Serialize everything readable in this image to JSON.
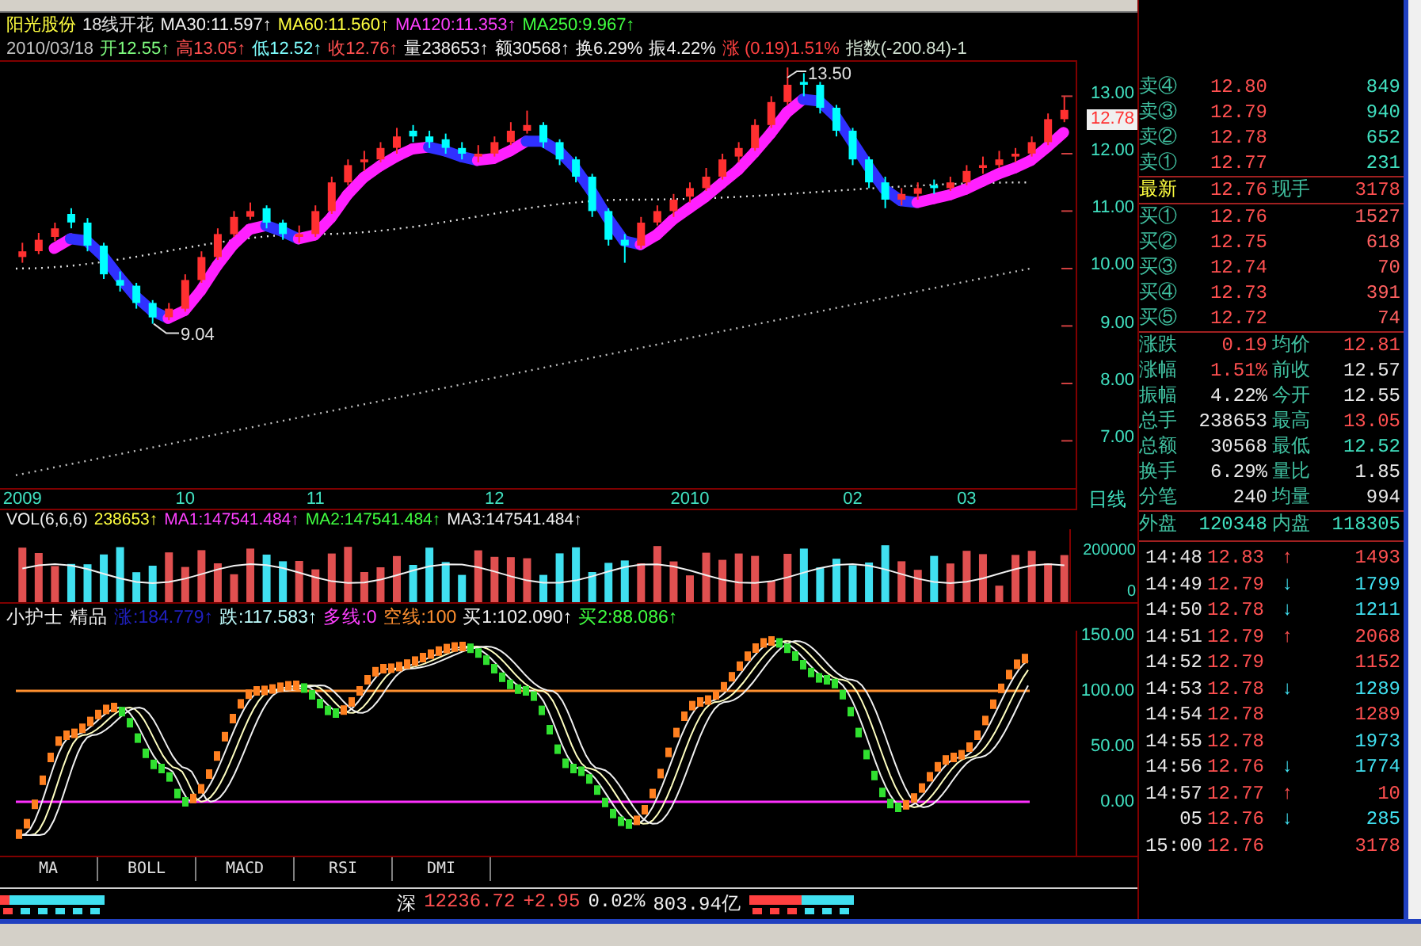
{
  "header": {
    "stock_name": "阳光股份",
    "formula_name": "18线开花",
    "ma_values": [
      {
        "text": "MA30:11.597↑",
        "color": "#f0f0f0"
      },
      {
        "text": "MA60:11.560↑",
        "color": "#ffff40"
      },
      {
        "text": "MA120:11.353↑",
        "color": "#ff40ff"
      },
      {
        "text": "MA250:9.967↑",
        "color": "#40ff40"
      }
    ],
    "quote_line": [
      {
        "text": "2010/03/18",
        "color": "#c0c0c0"
      },
      {
        "text": "开12.55↑",
        "color": "#80ff80"
      },
      {
        "text": "高13.05↑",
        "color": "#ff5050"
      },
      {
        "text": "低12.52↑",
        "color": "#80ffff"
      },
      {
        "text": "收12.76↑",
        "color": "#ff5050"
      },
      {
        "text": "量238653↑",
        "color": "#f0f0f0"
      },
      {
        "text": "额30568↑",
        "color": "#f0f0f0"
      },
      {
        "text": "换6.29%",
        "color": "#f0f0f0"
      },
      {
        "text": "振4.22%",
        "color": "#f0f0f0"
      },
      {
        "text": "涨 (0.19)1.51%",
        "color": "#ff4040"
      },
      {
        "text": "指数(-200.84)-1",
        "color": "#d0e0d0"
      }
    ]
  },
  "price_chart": {
    "high_label": "13.50",
    "low_label": "9.04",
    "current_price": "12.78",
    "chart_data": {
      "type": "candlestick",
      "categories": [
        "2009",
        null,
        null,
        null,
        null,
        null,
        null,
        null,
        null,
        null,
        "10",
        null,
        null,
        null,
        null,
        null,
        null,
        null,
        "11",
        null,
        null,
        null,
        null,
        null,
        null,
        null,
        null,
        null,
        null,
        "12",
        null,
        null,
        null,
        null,
        null,
        null,
        null,
        null,
        null,
        null,
        null,
        "2010",
        null,
        null,
        null,
        null,
        null,
        null,
        null,
        null,
        null,
        "02",
        null,
        null,
        null,
        null,
        null,
        null,
        "03",
        null,
        null,
        null,
        null,
        null,
        null
      ],
      "ohlc": [
        [
          10.2,
          10.45,
          10.1,
          10.3
        ],
        [
          10.3,
          10.62,
          10.25,
          10.5
        ],
        [
          10.55,
          10.8,
          10.48,
          10.7
        ],
        [
          10.95,
          11.05,
          10.7,
          10.8
        ],
        [
          10.8,
          10.88,
          10.3,
          10.4
        ],
        [
          10.4,
          10.45,
          9.82,
          9.9
        ],
        [
          9.8,
          9.95,
          9.6,
          9.7
        ],
        [
          9.7,
          9.75,
          9.3,
          9.4
        ],
        [
          9.4,
          9.45,
          9.04,
          9.15
        ],
        [
          9.15,
          9.4,
          9.1,
          9.3
        ],
        [
          9.3,
          9.9,
          9.25,
          9.8
        ],
        [
          9.8,
          10.3,
          9.75,
          10.2
        ],
        [
          10.2,
          10.7,
          10.15,
          10.6
        ],
        [
          10.6,
          11.0,
          10.55,
          10.9
        ],
        [
          10.9,
          11.15,
          10.85,
          11.0
        ],
        [
          11.05,
          11.1,
          10.7,
          10.8
        ],
        [
          10.8,
          10.85,
          10.5,
          10.6
        ],
        [
          10.55,
          10.75,
          10.45,
          10.6
        ],
        [
          10.6,
          11.1,
          10.55,
          11.0
        ],
        [
          11.0,
          11.6,
          10.95,
          11.5
        ],
        [
          11.5,
          11.9,
          11.45,
          11.8
        ],
        [
          11.85,
          12.05,
          11.7,
          11.9
        ],
        [
          11.9,
          12.2,
          11.85,
          12.1
        ],
        [
          12.1,
          12.45,
          12.0,
          12.3
        ],
        [
          12.4,
          12.5,
          12.2,
          12.3
        ],
        [
          12.3,
          12.4,
          12.1,
          12.2
        ],
        [
          12.25,
          12.35,
          12.0,
          12.1
        ],
        [
          12.1,
          12.2,
          11.9,
          12.0
        ],
        [
          11.95,
          12.15,
          11.85,
          12.0
        ],
        [
          12.0,
          12.3,
          11.95,
          12.2
        ],
        [
          12.2,
          12.55,
          12.15,
          12.4
        ],
        [
          12.4,
          12.75,
          12.35,
          12.5
        ],
        [
          12.5,
          12.55,
          12.1,
          12.2
        ],
        [
          12.2,
          12.25,
          11.8,
          11.9
        ],
        [
          11.9,
          11.95,
          11.5,
          11.6
        ],
        [
          11.6,
          11.65,
          10.9,
          11.0
        ],
        [
          11.0,
          11.05,
          10.4,
          10.5
        ],
        [
          10.5,
          10.6,
          10.1,
          10.4
        ],
        [
          10.4,
          10.9,
          10.35,
          10.8
        ],
        [
          10.8,
          11.1,
          10.75,
          11.0
        ],
        [
          11.0,
          11.3,
          10.9,
          11.2
        ],
        [
          11.25,
          11.5,
          11.15,
          11.4
        ],
        [
          11.4,
          11.75,
          11.35,
          11.6
        ],
        [
          11.6,
          12.0,
          11.55,
          11.9
        ],
        [
          11.95,
          12.2,
          11.85,
          12.1
        ],
        [
          12.1,
          12.6,
          12.05,
          12.5
        ],
        [
          12.5,
          13.0,
          12.45,
          12.9
        ],
        [
          12.9,
          13.5,
          12.85,
          13.2
        ],
        [
          13.25,
          13.4,
          13.0,
          13.2
        ],
        [
          13.2,
          13.25,
          12.7,
          12.8
        ],
        [
          12.8,
          12.85,
          12.3,
          12.4
        ],
        [
          12.4,
          12.45,
          11.8,
          11.9
        ],
        [
          11.9,
          11.95,
          11.4,
          11.5
        ],
        [
          11.5,
          11.6,
          11.05,
          11.2
        ],
        [
          11.2,
          11.4,
          11.1,
          11.3
        ],
        [
          11.3,
          11.5,
          11.2,
          11.4
        ],
        [
          11.45,
          11.55,
          11.3,
          11.4
        ],
        [
          11.4,
          11.6,
          11.35,
          11.5
        ],
        [
          11.5,
          11.8,
          11.45,
          11.7
        ],
        [
          11.75,
          11.95,
          11.65,
          11.8
        ],
        [
          11.8,
          12.05,
          11.75,
          11.9
        ],
        [
          11.95,
          12.1,
          11.85,
          12.0
        ],
        [
          12.0,
          12.3,
          11.95,
          12.2
        ],
        [
          12.2,
          12.7,
          12.15,
          12.6
        ],
        [
          12.6,
          13.0,
          12.55,
          12.76
        ]
      ],
      "ylim": [
        6.15,
        13.6
      ],
      "yticks": [
        {
          "value": 13,
          "label": "13.00"
        },
        {
          "value": 12,
          "label": "12.00"
        },
        {
          "value": 11,
          "label": "11.00"
        },
        {
          "value": 10,
          "label": "10.00"
        },
        {
          "value": 9,
          "label": "9.00"
        },
        {
          "value": 8,
          "label": "8.00"
        },
        {
          "value": 7,
          "label": "7.00"
        }
      ]
    }
  },
  "date_axis": {
    "period": "日线"
  },
  "volume": {
    "title": "VOL(6,6,6)",
    "values": [
      {
        "text": "238653↑",
        "color": "#ffff40"
      },
      {
        "text": "MA1:147541.484↑",
        "color": "#ff40ff"
      },
      {
        "text": "MA2:147541.484↑",
        "color": "#40ff40"
      },
      {
        "text": "MA3:147541.484↑",
        "color": "#f0f0f0"
      }
    ],
    "axis_labels": [
      "200000",
      "0"
    ]
  },
  "indicator": {
    "name": "小护士",
    "tag": "精品",
    "values": [
      {
        "text": "涨:184.779↑",
        "color": "#2020c0"
      },
      {
        "text": "跌:117.583↑",
        "color": "#c0ffff"
      },
      {
        "text": "多线:0",
        "color": "#ff40ff"
      },
      {
        "text": "空线:100",
        "color": "#ff9030"
      },
      {
        "text": "买1:102.090↑",
        "color": "#f0f0f0"
      },
      {
        "text": "买2:88.086↑",
        "color": "#40ff40"
      }
    ],
    "axis_labels": [
      "150.00",
      "100.00",
      "50.00",
      "0.00"
    ]
  },
  "tabs": [
    {
      "label": "MA",
      "selected": false
    },
    {
      "label": "BOLL",
      "selected": false
    },
    {
      "label": "MACD",
      "selected": false
    },
    {
      "label": "RSI",
      "selected": false
    },
    {
      "label": "DMI",
      "selected": false
    }
  ],
  "status": {
    "market": "深",
    "index": "12236.72",
    "change": "+2.95",
    "percent": "0.02%",
    "turnover": "803.94亿",
    "color": "#ff5050"
  },
  "order_book": {
    "asks": [
      {
        "label": "卖④",
        "price": "12.80",
        "volume": "849"
      },
      {
        "label": "卖③",
        "price": "12.79",
        "volume": "940"
      },
      {
        "label": "卖②",
        "price": "12.78",
        "volume": "652"
      },
      {
        "label": "卖①",
        "price": "12.77",
        "volume": "231"
      }
    ],
    "last": {
      "label": "最新",
      "price": "12.76",
      "label2": "现手",
      "volume": "3178"
    },
    "bids": [
      {
        "label": "买①",
        "price": "12.76",
        "volume": "1527"
      },
      {
        "label": "买②",
        "price": "12.75",
        "volume": "618"
      },
      {
        "label": "买③",
        "price": "12.74",
        "volume": "70"
      },
      {
        "label": "买④",
        "price": "12.73",
        "volume": "391"
      },
      {
        "label": "买⑤",
        "price": "12.72",
        "volume": "74"
      }
    ],
    "stats": [
      {
        "label": "涨跌",
        "value": "0.19",
        "color": "#ff5050"
      },
      {
        "label": "均价",
        "value": "12.81",
        "color": "#ff5050"
      },
      {
        "label": "涨幅",
        "value": "1.51%",
        "color": "#ff5050"
      },
      {
        "label": "前收",
        "value": "12.57",
        "color": "#e8e8e8"
      },
      {
        "label": "振幅",
        "value": "4.22%",
        "color": "#e8e8e8"
      },
      {
        "label": "今开",
        "value": "12.55",
        "color": "#e8e8e8"
      },
      {
        "label": "总手",
        "value": "238653",
        "color": "#e8e8e8"
      },
      {
        "label": "最高",
        "value": "13.05",
        "color": "#ff5050"
      },
      {
        "label": "总额",
        "value": "30568",
        "color": "#e8e8e8"
      },
      {
        "label": "最低",
        "value": "12.52",
        "color": "#40e0c0"
      },
      {
        "label": "换手",
        "value": "6.29%",
        "color": "#e8e8e8"
      },
      {
        "label": "量比",
        "value": "1.85",
        "color": "#e8e8e8"
      },
      {
        "label": "分笔",
        "value": "240",
        "color": "#e8e8e8"
      },
      {
        "label": "均量",
        "value": "994",
        "color": "#e8e8e8"
      },
      {
        "label": "外盘",
        "value": "120348",
        "color": "#40e0c0"
      },
      {
        "label": "内盘",
        "value": "118305",
        "color": "#40e0c0"
      }
    ],
    "ticks": [
      {
        "time": "14:48",
        "price": "12.83",
        "arrow": "↑",
        "volume": "1493",
        "color": "#ff5050"
      },
      {
        "time": "14:49",
        "price": "12.79",
        "arrow": "↓",
        "volume": "1799",
        "color": "#40e0f0"
      },
      {
        "time": "14:50",
        "price": "12.78",
        "arrow": "↓",
        "volume": "1211",
        "color": "#40e0f0"
      },
      {
        "time": "14:51",
        "price": "12.79",
        "arrow": "↑",
        "volume": "2068",
        "color": "#ff5050"
      },
      {
        "time": "14:52",
        "price": "12.79",
        "volume": "1152",
        "color": "#ff5050"
      },
      {
        "time": "14:53",
        "price": "12.78",
        "arrow": "↓",
        "volume": "1289",
        "color": "#40e0f0"
      },
      {
        "time": "14:54",
        "price": "12.78",
        "volume": "1289",
        "color": "#ff5050"
      },
      {
        "time": "14:55",
        "price": "12.78",
        "volume": "1973",
        "color": "#40e0f0"
      },
      {
        "time": "14:56",
        "price": "12.76",
        "arrow": "↓",
        "volume": "1774",
        "color": "#40e0f0"
      },
      {
        "time": "14:57",
        "price": "12.77",
        "arrow": "↑",
        "volume": "10",
        "color": "#ff5050"
      },
      {
        "time": "05",
        "price": "12.76",
        "arrow": "↓",
        "volume": "285",
        "color": "#40e0f0"
      },
      {
        "time": "15:00",
        "price": "12.76",
        "volume": "3178",
        "color": "#ff5050"
      }
    ]
  }
}
